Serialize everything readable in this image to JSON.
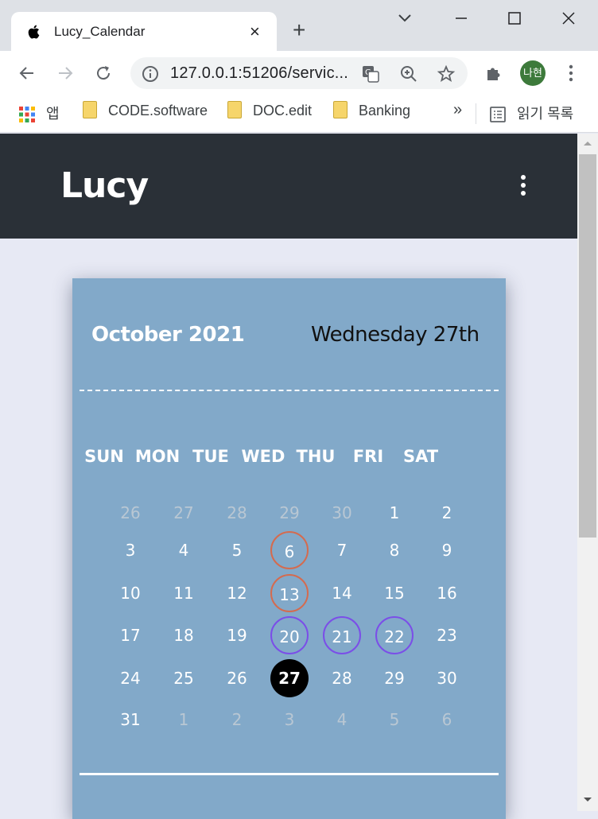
{
  "browser": {
    "tab_title": "Lucy_Calendar",
    "tab_close": "×",
    "new_tab": "+",
    "url": "127.0.0.1:51206/servic...",
    "profile": "나현",
    "bookmarks": [
      {
        "label": "앱",
        "icon": "apps-grid-icon"
      },
      {
        "label": "CODE.software",
        "icon": "folder-icon"
      },
      {
        "label": "DOC.edit",
        "icon": "folder-icon"
      },
      {
        "label": "Banking",
        "icon": "folder-icon"
      }
    ],
    "overflow": "»",
    "reading_list": "읽기 목록"
  },
  "app": {
    "brand": "Lucy"
  },
  "calendar": {
    "month_label": "October 2021",
    "today_label": "Wednesday 27th",
    "weekdays": [
      "SUN",
      "MON",
      "TUE",
      "WED",
      "THU",
      "FRI",
      "SAT"
    ],
    "weeks": [
      [
        "26",
        "27",
        "28",
        "29",
        "30",
        "1",
        "2"
      ],
      [
        "3",
        "4",
        "5",
        "6",
        "7",
        "8",
        "9"
      ],
      [
        "10",
        "11",
        "12",
        "13",
        "14",
        "15",
        "16"
      ],
      [
        "17",
        "18",
        "19",
        "20",
        "21",
        "22",
        "23"
      ],
      [
        "24",
        "25",
        "26",
        "27",
        "28",
        "29",
        "30"
      ],
      [
        "31",
        "1",
        "2",
        "3",
        "4",
        "5",
        "6"
      ]
    ],
    "colors": {
      "card": "#82a9c9",
      "ring_orange": "#d46b4f",
      "ring_violet": "#7b4ee8",
      "today_fill": "#000000"
    }
  }
}
